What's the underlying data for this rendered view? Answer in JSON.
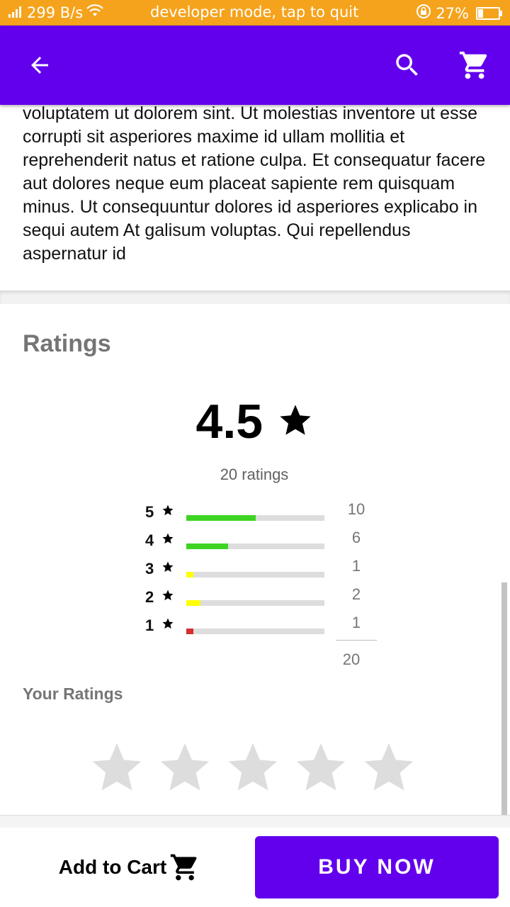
{
  "status_bar": {
    "net_speed": "299 B/s",
    "dev_message": "developer mode, tap to quit",
    "battery_percent": "27%",
    "battery_level": 0.27
  },
  "app_bar": {
    "icons": [
      "arrow-back-icon",
      "search-icon",
      "cart-icon"
    ],
    "color": "#6200ee"
  },
  "description": {
    "text": "voluptatem ut dolorem sint. Ut molestias inventore ut esse corrupti sit asperiores maxime id ullam mollitia et reprehenderit natus et ratione culpa. Et consequatur facere aut dolores neque eum placeat sapiente rem quisquam minus.  Ut consequuntur dolores id asperiores explicabo in sequi autem At galisum voluptas. Qui repellendus aspernatur id"
  },
  "ratings": {
    "title": "Ratings",
    "average": "4.5",
    "total_text": "20 ratings",
    "distribution": [
      {
        "stars": "5",
        "count": "10",
        "fraction": 0.5,
        "color": "#3ed424"
      },
      {
        "stars": "4",
        "count": "6",
        "fraction": 0.3,
        "color": "#3ed424"
      },
      {
        "stars": "3",
        "count": "1",
        "fraction": 0.05,
        "color": "#ffff00"
      },
      {
        "stars": "2",
        "count": "2",
        "fraction": 0.1,
        "color": "#ffff00"
      },
      {
        "stars": "1",
        "count": "1",
        "fraction": 0.05,
        "color": "#d32f2f"
      }
    ],
    "total": "20"
  },
  "your_ratings": {
    "title": "Your Ratings",
    "value": 0,
    "max": 5,
    "empty_color": "#dddddd"
  },
  "bottom_bar": {
    "add_to_cart_label": "Add to Cart",
    "buy_now_label": "BUY NOW"
  }
}
